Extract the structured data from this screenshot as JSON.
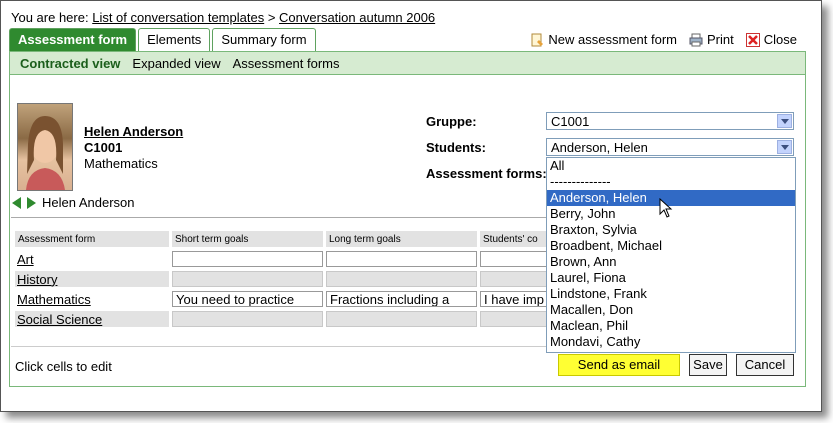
{
  "breadcrumb": {
    "prefix": "You are here:",
    "link1": "List of conversation templates",
    "separator": ">",
    "link2": "Conversation autumn 2006"
  },
  "tabs": [
    "Assessment form",
    "Elements",
    "Summary form"
  ],
  "toolbar": {
    "new_label": "New assessment form",
    "print_label": "Print",
    "close_label": "Close"
  },
  "subnav": [
    "Contracted view",
    "Expanded view",
    "Assessment forms"
  ],
  "student": {
    "name": "Helen Anderson",
    "class": "C1001",
    "subject": "Mathematics",
    "nav_name": "Helen Anderson"
  },
  "form": {
    "group_label": "Gruppe:",
    "group_value": "C1001",
    "students_label": "Students:",
    "students_value": "Anderson, Helen",
    "assessment_label": "Assessment forms:"
  },
  "dropdown_options": [
    "All",
    "--------------",
    "Anderson, Helen",
    "Berry, John",
    "Braxton, Sylvia",
    "Broadbent, Michael",
    "Brown, Ann",
    "Laurel, Fiona",
    "Lindstone, Frank",
    "Macallen, Don",
    "Maclean, Phil",
    "Mondavi, Cathy"
  ],
  "table": {
    "headers": [
      "Assessment form",
      "Short term goals",
      "Long term goals",
      "Students' co"
    ],
    "rows": [
      {
        "label": "Art",
        "cells": [
          "",
          "",
          ""
        ]
      },
      {
        "label": "History",
        "cells": [
          "",
          "",
          ""
        ]
      },
      {
        "label": "Mathematics",
        "cells": [
          "You need to practice",
          "Fractions including a",
          "I have imp"
        ]
      },
      {
        "label": "Social Science",
        "cells": [
          "",
          "",
          ""
        ]
      }
    ]
  },
  "footer": {
    "hint": "Click cells to edit",
    "send_label": "Send as email",
    "save_label": "Save",
    "cancel_label": "Cancel"
  },
  "colors": {
    "accent_green": "#2f8a2f",
    "subnav_bg": "#d6ebd1",
    "selected_option": "#316ac5",
    "send_button": "#ffff33"
  }
}
